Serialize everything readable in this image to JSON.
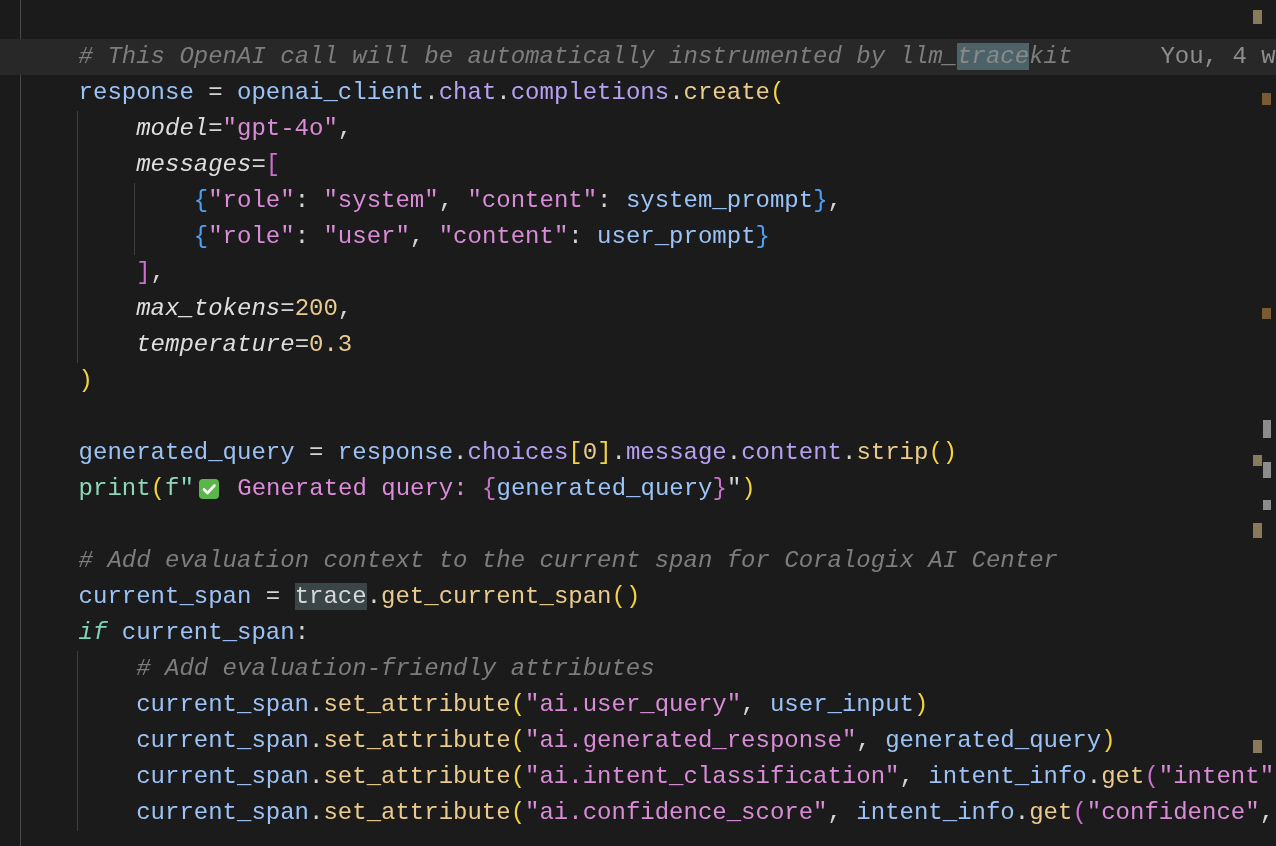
{
  "editor": {
    "lines": [
      {
        "kind": "code",
        "current": true,
        "blame": "You, 4 w",
        "tokens": [
          {
            "text": "    # This OpenAI call will be automatically instrumented by llm_",
            "kind": "comment"
          },
          {
            "text": "trace",
            "kind": "comment-match"
          },
          {
            "text": "kit",
            "kind": "comment"
          }
        ]
      },
      {
        "kind": "code",
        "current": false,
        "tokens": [
          {
            "text": "    response",
            "kind": "var"
          },
          {
            "text": " = ",
            "kind": "op"
          },
          {
            "text": "openai_client",
            "kind": "var"
          },
          {
            "text": ".",
            "kind": "op"
          },
          {
            "text": "chat",
            "kind": "prop"
          },
          {
            "text": ".",
            "kind": "op"
          },
          {
            "text": "completions",
            "kind": "prop"
          },
          {
            "text": ".",
            "kind": "op"
          },
          {
            "text": "create",
            "kind": "func"
          },
          {
            "text": "(",
            "kind": "p1"
          }
        ]
      },
      {
        "kind": "code",
        "current": false,
        "tokens": [
          {
            "text": "        model",
            "kind": "param"
          },
          {
            "text": "=",
            "kind": "op"
          },
          {
            "text": "\"gpt-4o\"",
            "kind": "str"
          },
          {
            "text": ",",
            "kind": "op"
          }
        ]
      },
      {
        "kind": "code",
        "current": false,
        "tokens": [
          {
            "text": "        messages",
            "kind": "param"
          },
          {
            "text": "=",
            "kind": "op"
          },
          {
            "text": "[",
            "kind": "p2"
          }
        ]
      },
      {
        "kind": "code",
        "current": false,
        "tokens": [
          {
            "text": "            {",
            "kind": "p3"
          },
          {
            "text": "\"role\"",
            "kind": "str"
          },
          {
            "text": ": ",
            "kind": "op"
          },
          {
            "text": "\"system\"",
            "kind": "str"
          },
          {
            "text": ", ",
            "kind": "op"
          },
          {
            "text": "\"content\"",
            "kind": "str"
          },
          {
            "text": ": ",
            "kind": "op"
          },
          {
            "text": "system_prompt",
            "kind": "var"
          },
          {
            "text": "}",
            "kind": "p3"
          },
          {
            "text": ",",
            "kind": "op"
          }
        ]
      },
      {
        "kind": "code",
        "current": false,
        "tokens": [
          {
            "text": "            {",
            "kind": "p3"
          },
          {
            "text": "\"role\"",
            "kind": "str"
          },
          {
            "text": ": ",
            "kind": "op"
          },
          {
            "text": "\"user\"",
            "kind": "str"
          },
          {
            "text": ", ",
            "kind": "op"
          },
          {
            "text": "\"content\"",
            "kind": "str"
          },
          {
            "text": ": ",
            "kind": "op"
          },
          {
            "text": "user_prompt",
            "kind": "var"
          },
          {
            "text": "}",
            "kind": "p3"
          }
        ]
      },
      {
        "kind": "code",
        "current": false,
        "tokens": [
          {
            "text": "        ]",
            "kind": "p2"
          },
          {
            "text": ",",
            "kind": "op"
          }
        ]
      },
      {
        "kind": "code",
        "current": false,
        "tokens": [
          {
            "text": "        max_tokens",
            "kind": "param"
          },
          {
            "text": "=",
            "kind": "op"
          },
          {
            "text": "200",
            "kind": "num"
          },
          {
            "text": ",",
            "kind": "op"
          }
        ]
      },
      {
        "kind": "code",
        "current": false,
        "tokens": [
          {
            "text": "        temperature",
            "kind": "param"
          },
          {
            "text": "=",
            "kind": "op"
          },
          {
            "text": "0.3",
            "kind": "num"
          }
        ]
      },
      {
        "kind": "code",
        "current": false,
        "tokens": [
          {
            "text": "    )",
            "kind": "p1"
          }
        ]
      },
      {
        "kind": "blank",
        "current": false
      },
      {
        "kind": "code",
        "current": false,
        "tokens": [
          {
            "text": "    generated_query",
            "kind": "var"
          },
          {
            "text": " = ",
            "kind": "op"
          },
          {
            "text": "response",
            "kind": "var"
          },
          {
            "text": ".",
            "kind": "op"
          },
          {
            "text": "choices",
            "kind": "prop"
          },
          {
            "text": "[",
            "kind": "p1"
          },
          {
            "text": "0",
            "kind": "num"
          },
          {
            "text": "]",
            "kind": "p1"
          },
          {
            "text": ".",
            "kind": "op"
          },
          {
            "text": "message",
            "kind": "prop"
          },
          {
            "text": ".",
            "kind": "op"
          },
          {
            "text": "content",
            "kind": "prop"
          },
          {
            "text": ".",
            "kind": "op"
          },
          {
            "text": "strip",
            "kind": "func"
          },
          {
            "text": "()",
            "kind": "p1"
          }
        ]
      },
      {
        "kind": "code",
        "current": false,
        "tokens": [
          {
            "text": "    print",
            "kind": "builtin"
          },
          {
            "text": "(",
            "kind": "p1"
          },
          {
            "text": "f\"",
            "kind": "builtin"
          },
          {
            "kind": "check-emoji"
          },
          {
            "text": " Generated query: ",
            "kind": "str"
          },
          {
            "text": "{",
            "kind": "p2"
          },
          {
            "text": "generated_query",
            "kind": "var"
          },
          {
            "text": "}",
            "kind": "p2"
          },
          {
            "text": "\"",
            "kind": "op"
          },
          {
            "text": ")",
            "kind": "p1"
          }
        ]
      },
      {
        "kind": "blank",
        "current": false
      },
      {
        "kind": "code",
        "current": false,
        "tokens": [
          {
            "text": "    # Add evaluation context to the current span for Coralogix AI Center",
            "kind": "comment"
          }
        ]
      },
      {
        "kind": "code",
        "current": false,
        "tokens": [
          {
            "text": "    current_span",
            "kind": "var"
          },
          {
            "text": " = ",
            "kind": "op"
          },
          {
            "text": "trace",
            "kind": "match"
          },
          {
            "text": ".",
            "kind": "op"
          },
          {
            "text": "get_current_span",
            "kind": "func"
          },
          {
            "text": "()",
            "kind": "p1"
          }
        ]
      },
      {
        "kind": "code",
        "current": false,
        "tokens": [
          {
            "text": "    if ",
            "kind": "kw"
          },
          {
            "text": "current_span",
            "kind": "var"
          },
          {
            "text": ":",
            "kind": "op"
          }
        ]
      },
      {
        "kind": "code",
        "current": false,
        "tokens": [
          {
            "text": "        # Add evaluation-friendly attributes",
            "kind": "comment"
          }
        ]
      },
      {
        "kind": "code",
        "current": false,
        "tokens": [
          {
            "text": "        current_span",
            "kind": "var"
          },
          {
            "text": ".",
            "kind": "op"
          },
          {
            "text": "set_attribute",
            "kind": "func"
          },
          {
            "text": "(",
            "kind": "p1"
          },
          {
            "text": "\"ai.user_query\"",
            "kind": "str"
          },
          {
            "text": ", ",
            "kind": "op"
          },
          {
            "text": "user_input",
            "kind": "var"
          },
          {
            "text": ")",
            "kind": "p1"
          }
        ]
      },
      {
        "kind": "code",
        "current": false,
        "tokens": [
          {
            "text": "        current_span",
            "kind": "var"
          },
          {
            "text": ".",
            "kind": "op"
          },
          {
            "text": "set_attribute",
            "kind": "func"
          },
          {
            "text": "(",
            "kind": "p1"
          },
          {
            "text": "\"ai.generated_response\"",
            "kind": "str"
          },
          {
            "text": ", ",
            "kind": "op"
          },
          {
            "text": "generated_query",
            "kind": "var"
          },
          {
            "text": ")",
            "kind": "p1"
          }
        ]
      },
      {
        "kind": "code",
        "current": false,
        "tokens": [
          {
            "text": "        current_span",
            "kind": "var"
          },
          {
            "text": ".",
            "kind": "op"
          },
          {
            "text": "set_attribute",
            "kind": "func"
          },
          {
            "text": "(",
            "kind": "p1"
          },
          {
            "text": "\"ai.intent_classification\"",
            "kind": "str"
          },
          {
            "text": ", ",
            "kind": "op"
          },
          {
            "text": "intent_info",
            "kind": "var"
          },
          {
            "text": ".",
            "kind": "op"
          },
          {
            "text": "get",
            "kind": "func"
          },
          {
            "text": "(",
            "kind": "p2"
          },
          {
            "text": "\"intent\"",
            "kind": "str"
          }
        ]
      },
      {
        "kind": "code",
        "current": false,
        "tokens": [
          {
            "text": "        current_span",
            "kind": "var"
          },
          {
            "text": ".",
            "kind": "op"
          },
          {
            "text": "set_attribute",
            "kind": "func"
          },
          {
            "text": "(",
            "kind": "p1"
          },
          {
            "text": "\"ai.confidence_score\"",
            "kind": "str"
          },
          {
            "text": ", ",
            "kind": "op"
          },
          {
            "text": "intent_info",
            "kind": "var"
          },
          {
            "text": ".",
            "kind": "op"
          },
          {
            "text": "get",
            "kind": "func"
          },
          {
            "text": "(",
            "kind": "p2"
          },
          {
            "text": "\"confidence\"",
            "kind": "str"
          },
          {
            "text": ",",
            "kind": "op"
          }
        ]
      }
    ]
  }
}
